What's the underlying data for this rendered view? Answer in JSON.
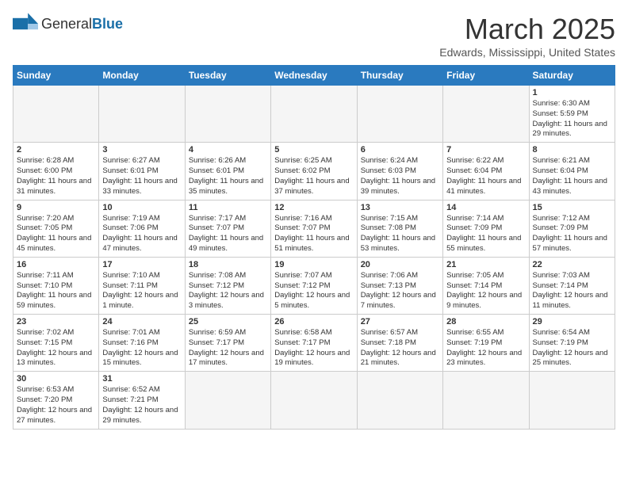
{
  "header": {
    "logo_general": "General",
    "logo_blue": "Blue",
    "month": "March 2025",
    "location": "Edwards, Mississippi, United States"
  },
  "days_of_week": [
    "Sunday",
    "Monday",
    "Tuesday",
    "Wednesday",
    "Thursday",
    "Friday",
    "Saturday"
  ],
  "weeks": [
    [
      {
        "day": "",
        "info": ""
      },
      {
        "day": "",
        "info": ""
      },
      {
        "day": "",
        "info": ""
      },
      {
        "day": "",
        "info": ""
      },
      {
        "day": "",
        "info": ""
      },
      {
        "day": "",
        "info": ""
      },
      {
        "day": "1",
        "info": "Sunrise: 6:30 AM\nSunset: 5:59 PM\nDaylight: 11 hours and 29 minutes."
      }
    ],
    [
      {
        "day": "2",
        "info": "Sunrise: 6:28 AM\nSunset: 6:00 PM\nDaylight: 11 hours and 31 minutes."
      },
      {
        "day": "3",
        "info": "Sunrise: 6:27 AM\nSunset: 6:01 PM\nDaylight: 11 hours and 33 minutes."
      },
      {
        "day": "4",
        "info": "Sunrise: 6:26 AM\nSunset: 6:01 PM\nDaylight: 11 hours and 35 minutes."
      },
      {
        "day": "5",
        "info": "Sunrise: 6:25 AM\nSunset: 6:02 PM\nDaylight: 11 hours and 37 minutes."
      },
      {
        "day": "6",
        "info": "Sunrise: 6:24 AM\nSunset: 6:03 PM\nDaylight: 11 hours and 39 minutes."
      },
      {
        "day": "7",
        "info": "Sunrise: 6:22 AM\nSunset: 6:04 PM\nDaylight: 11 hours and 41 minutes."
      },
      {
        "day": "8",
        "info": "Sunrise: 6:21 AM\nSunset: 6:04 PM\nDaylight: 11 hours and 43 minutes."
      }
    ],
    [
      {
        "day": "9",
        "info": "Sunrise: 7:20 AM\nSunset: 7:05 PM\nDaylight: 11 hours and 45 minutes."
      },
      {
        "day": "10",
        "info": "Sunrise: 7:19 AM\nSunset: 7:06 PM\nDaylight: 11 hours and 47 minutes."
      },
      {
        "day": "11",
        "info": "Sunrise: 7:17 AM\nSunset: 7:07 PM\nDaylight: 11 hours and 49 minutes."
      },
      {
        "day": "12",
        "info": "Sunrise: 7:16 AM\nSunset: 7:07 PM\nDaylight: 11 hours and 51 minutes."
      },
      {
        "day": "13",
        "info": "Sunrise: 7:15 AM\nSunset: 7:08 PM\nDaylight: 11 hours and 53 minutes."
      },
      {
        "day": "14",
        "info": "Sunrise: 7:14 AM\nSunset: 7:09 PM\nDaylight: 11 hours and 55 minutes."
      },
      {
        "day": "15",
        "info": "Sunrise: 7:12 AM\nSunset: 7:09 PM\nDaylight: 11 hours and 57 minutes."
      }
    ],
    [
      {
        "day": "16",
        "info": "Sunrise: 7:11 AM\nSunset: 7:10 PM\nDaylight: 11 hours and 59 minutes."
      },
      {
        "day": "17",
        "info": "Sunrise: 7:10 AM\nSunset: 7:11 PM\nDaylight: 12 hours and 1 minute."
      },
      {
        "day": "18",
        "info": "Sunrise: 7:08 AM\nSunset: 7:12 PM\nDaylight: 12 hours and 3 minutes."
      },
      {
        "day": "19",
        "info": "Sunrise: 7:07 AM\nSunset: 7:12 PM\nDaylight: 12 hours and 5 minutes."
      },
      {
        "day": "20",
        "info": "Sunrise: 7:06 AM\nSunset: 7:13 PM\nDaylight: 12 hours and 7 minutes."
      },
      {
        "day": "21",
        "info": "Sunrise: 7:05 AM\nSunset: 7:14 PM\nDaylight: 12 hours and 9 minutes."
      },
      {
        "day": "22",
        "info": "Sunrise: 7:03 AM\nSunset: 7:14 PM\nDaylight: 12 hours and 11 minutes."
      }
    ],
    [
      {
        "day": "23",
        "info": "Sunrise: 7:02 AM\nSunset: 7:15 PM\nDaylight: 12 hours and 13 minutes."
      },
      {
        "day": "24",
        "info": "Sunrise: 7:01 AM\nSunset: 7:16 PM\nDaylight: 12 hours and 15 minutes."
      },
      {
        "day": "25",
        "info": "Sunrise: 6:59 AM\nSunset: 7:17 PM\nDaylight: 12 hours and 17 minutes."
      },
      {
        "day": "26",
        "info": "Sunrise: 6:58 AM\nSunset: 7:17 PM\nDaylight: 12 hours and 19 minutes."
      },
      {
        "day": "27",
        "info": "Sunrise: 6:57 AM\nSunset: 7:18 PM\nDaylight: 12 hours and 21 minutes."
      },
      {
        "day": "28",
        "info": "Sunrise: 6:55 AM\nSunset: 7:19 PM\nDaylight: 12 hours and 23 minutes."
      },
      {
        "day": "29",
        "info": "Sunrise: 6:54 AM\nSunset: 7:19 PM\nDaylight: 12 hours and 25 minutes."
      }
    ],
    [
      {
        "day": "30",
        "info": "Sunrise: 6:53 AM\nSunset: 7:20 PM\nDaylight: 12 hours and 27 minutes."
      },
      {
        "day": "31",
        "info": "Sunrise: 6:52 AM\nSunset: 7:21 PM\nDaylight: 12 hours and 29 minutes."
      },
      {
        "day": "",
        "info": ""
      },
      {
        "day": "",
        "info": ""
      },
      {
        "day": "",
        "info": ""
      },
      {
        "day": "",
        "info": ""
      },
      {
        "day": "",
        "info": ""
      }
    ]
  ]
}
